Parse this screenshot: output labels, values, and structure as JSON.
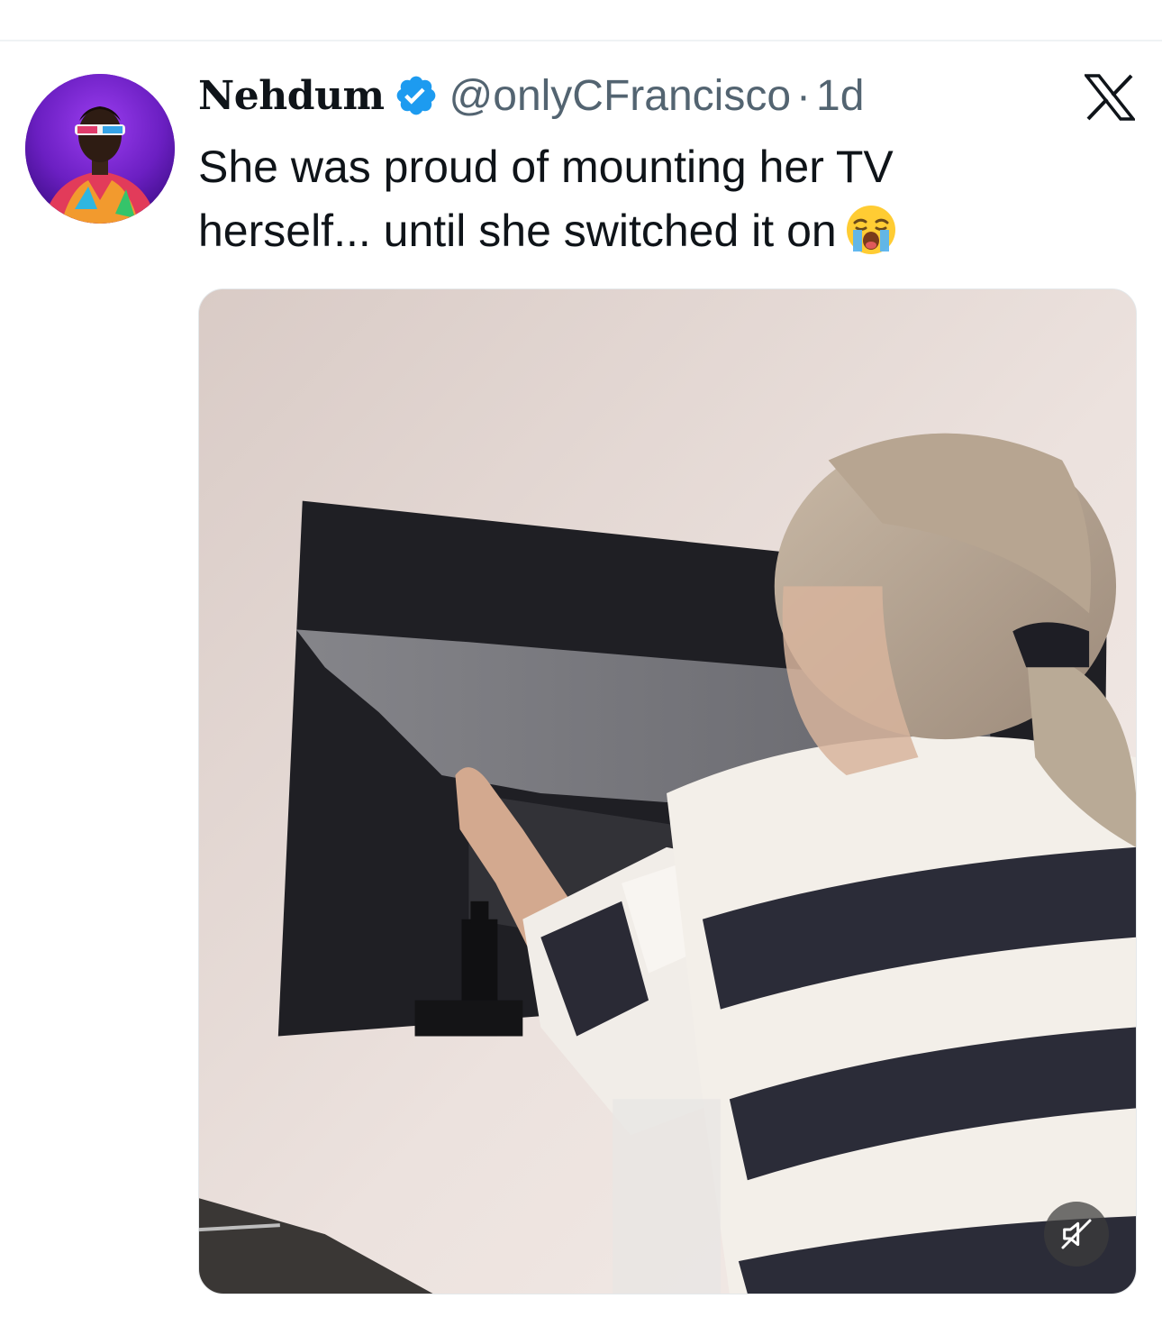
{
  "tweet": {
    "author": {
      "display_name": "Nehdum",
      "handle": "@onlyCFrancisco",
      "verified": true,
      "avatar": "avatar-photo"
    },
    "separator": "·",
    "timestamp": "1d",
    "text_lines": [
      "She was proud of mounting her TV",
      "herself... until she switched it on"
    ],
    "emoji": "loudly-crying-face-icon",
    "media": {
      "type": "video",
      "muted": true,
      "mute_icon": "speaker-muted-icon"
    }
  },
  "brand": {
    "logo": "x-logo-icon"
  },
  "colors": {
    "text_primary": "#0f1419",
    "text_secondary": "#536471",
    "verified_blue": "#1d9bf0",
    "divider": "#eff3f4"
  }
}
